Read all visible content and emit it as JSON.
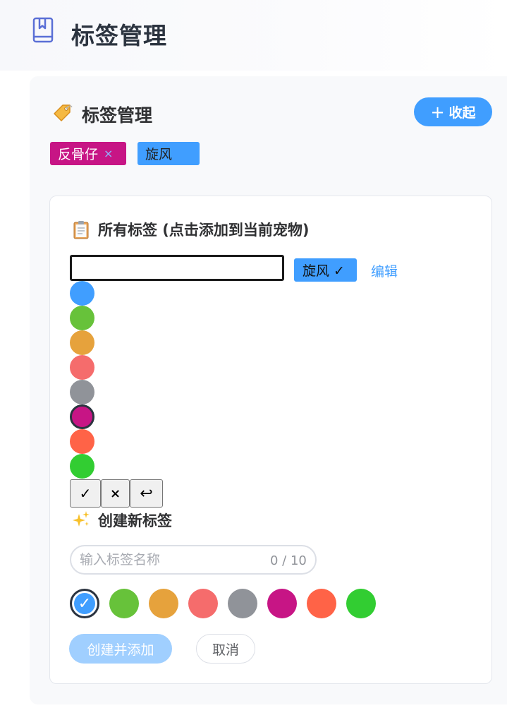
{
  "header": {
    "title": "标签管理",
    "icon": "book-icon"
  },
  "panel": {
    "title": "标签管理",
    "title_icon": "tag-icon",
    "collapse_label": "收起",
    "collapse_icon": "plus-icon",
    "current_tags": [
      {
        "label": "反骨仔",
        "color": "#c71585",
        "remove_symbol": "×"
      },
      {
        "label": "旋风",
        "color": "#409eff"
      }
    ]
  },
  "all_tags": {
    "title": "所有标签 (点击添加到当前宠物)",
    "title_icon": "clipboard-icon",
    "edit_input_value": "",
    "items": [
      {
        "label": "旋风 ✓",
        "color": "#409eff"
      }
    ],
    "edit_link": "编辑",
    "edit_colors": [
      "#409eff",
      "#67c23a",
      "#e6a23c",
      "#f56c6c",
      "#909399",
      "#c71585",
      "#ff6347",
      "#32cd32"
    ],
    "edit_selected_color": "#c71585",
    "confirm_symbol": "✓",
    "cancel_symbol": "×",
    "undo_symbol": "↩"
  },
  "create": {
    "title": "创建新标签",
    "title_icon": "sparkles-icon",
    "input_placeholder": "输入标签名称",
    "input_value": "",
    "counter": "0 / 10",
    "colors": [
      "#409eff",
      "#67c23a",
      "#e6a23c",
      "#f56c6c",
      "#909399",
      "#c71585",
      "#ff6347",
      "#32cd32"
    ],
    "selected_color": "#409eff",
    "selected_mark": "✓",
    "create_label": "创建并添加",
    "cancel_label": "取消"
  }
}
